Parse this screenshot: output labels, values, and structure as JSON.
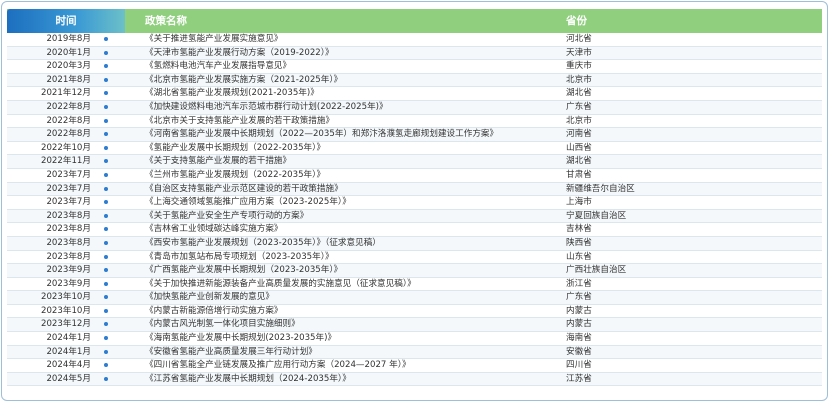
{
  "header": {
    "time": "时间",
    "title": "政策名称",
    "province": "省份"
  },
  "rows": [
    {
      "time": "2019年8月",
      "title": "《关于推进氢能产业发展实施意见》",
      "province": "河北省"
    },
    {
      "time": "2020年1月",
      "title": "《天津市氢能产业发展行动方案（2019-2022）》",
      "province": "天津市"
    },
    {
      "time": "2020年3月",
      "title": "《氢燃料电池汽车产业发展指导意见》",
      "province": "重庆市"
    },
    {
      "time": "2021年8月",
      "title": "《北京市氢能产业发展实施方案（2021-2025年）》",
      "province": "北京市"
    },
    {
      "time": "2021年12月",
      "title": "《湖北省氢能产业发展规划(2021-2035年)》",
      "province": "湖北省"
    },
    {
      "time": "2022年8月",
      "title": "《加快建设燃料电池汽车示范城市群行动计划(2022-2025年)》",
      "province": "广东省"
    },
    {
      "time": "2022年8月",
      "title": "《北京市关于支持氢能产业发展的若干政策措施》",
      "province": "北京市"
    },
    {
      "time": "2022年8月",
      "title": "《河南省氢能产业发展中长期规划（2022—2035年）和郑汴洛濮氢走廊规划建设工作方案》",
      "province": "河南省"
    },
    {
      "time": "2022年10月",
      "title": "《氢能产业发展中长期规划（2022-2035年）》",
      "province": "山西省"
    },
    {
      "time": "2022年11月",
      "title": "《关于支持氢能产业发展的若干措施》",
      "province": "湖北省"
    },
    {
      "time": "2023年7月",
      "title": "《兰州市氢能产业发展规划（2022-2035年）》",
      "province": "甘肃省"
    },
    {
      "time": "2023年7月",
      "title": "《自治区支持氢能产业示范区建设的若干政策措施》",
      "province": "新疆维吾尔自治区"
    },
    {
      "time": "2023年7月",
      "title": "《上海交通领域氢能推广应用方案（2023-2025年）》",
      "province": "上海市"
    },
    {
      "time": "2023年8月",
      "title": "《关于氢能产业安全生产专项行动的方案》",
      "province": "宁夏回族自治区"
    },
    {
      "time": "2023年8月",
      "title": "《吉林省工业领域碳达峰实施方案》",
      "province": "吉林省"
    },
    {
      "time": "2023年8月",
      "title": "《西安市氢能产业发展规划（2023-2035年）》（征求意见稿）",
      "province": "陕西省"
    },
    {
      "time": "2023年8月",
      "title": "《青岛市加氢站布局专项规划（2023-2035年）》",
      "province": "山东省"
    },
    {
      "time": "2023年9月",
      "title": "《广西氢能产业发展中长期规划（2023-2035年）》",
      "province": "广西壮族自治区"
    },
    {
      "time": "2023年9月",
      "title": "《关于加快推进新能源装备产业高质量发展的实施意见（征求意见稿）》",
      "province": "浙江省"
    },
    {
      "time": "2023年10月",
      "title": "《加快氢能产业创新发展的意见》",
      "province": "广东省"
    },
    {
      "time": "2023年10月",
      "title": "《内蒙古新能源倍增行动实施方案》",
      "province": "内蒙古"
    },
    {
      "time": "2023年12月",
      "title": "《内蒙古风光制氢一体化项目实施细则》",
      "province": "内蒙古"
    },
    {
      "time": "2024年1月",
      "title": "《海南氢能产业发展中长期规划(2023-2035年)》",
      "province": "海南省"
    },
    {
      "time": "2024年1月",
      "title": "《安徽省氢能产业高质量发展三年行动计划》",
      "province": "安徽省"
    },
    {
      "time": "2024年4月",
      "title": "《四川省氢能全产业链发展及推广应用行动方案（2024—2027 年）》",
      "province": "四川省"
    },
    {
      "time": "2024年5月",
      "title": "《江苏省氢能产业发展中长期规划（2024-2035年）》",
      "province": "江苏省"
    }
  ]
}
